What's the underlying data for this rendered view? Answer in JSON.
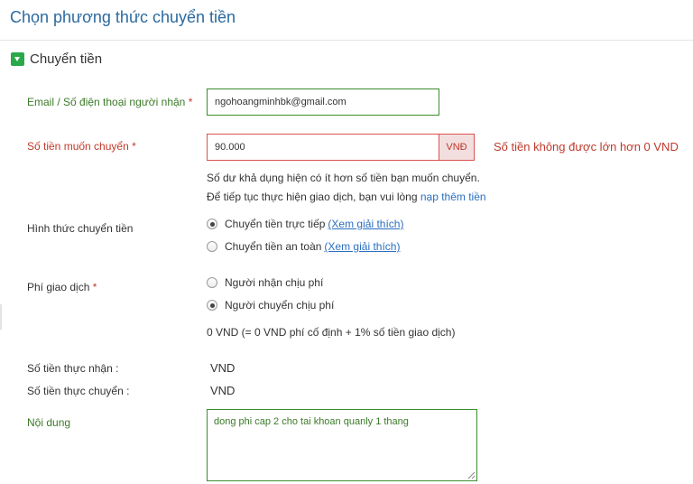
{
  "page": {
    "title": "Chọn phương thức chuyển tiền"
  },
  "section": {
    "title": "Chuyển tiền",
    "toggle_icon": "triangle-down-icon",
    "toggle_color": "#2aa84a"
  },
  "form": {
    "email": {
      "label": "Email / Số điện thoại người nhận",
      "required_mark": "*",
      "value": "ngohoangminhbk@gmail.com"
    },
    "amount": {
      "label": "Số tiền muốn chuyển",
      "required_mark": "*",
      "value": "90.000",
      "currency_addon": "VNĐ",
      "error": "Số tiền không được lớn hơn 0 VND",
      "help_line1": "Số dư khả dụng hiện có ít hơn số tiền bạn muốn chuyển.",
      "help_line2_prefix": "Để tiếp tục thực hiện giao dịch, bạn vui lòng",
      "help_link": "nạp thêm tiền"
    },
    "transfer_method": {
      "label": "Hình thức chuyển tiền",
      "options": [
        {
          "label": "Chuyển tiền trực tiếp",
          "link": "(Xem giải thích)",
          "checked": true
        },
        {
          "label": "Chuyển tiền an toàn",
          "link": "(Xem giải thích)",
          "checked": false
        }
      ]
    },
    "fee": {
      "label": "Phí giao dịch",
      "required_mark": "*",
      "options": [
        {
          "label": "Người nhận chịu phí",
          "checked": false
        },
        {
          "label": "Người chuyển chịu phí",
          "checked": true
        }
      ],
      "summary": "0 VND (= 0 VND phí cố định + 1% số tiền giao dịch)"
    },
    "received": {
      "label": "Số tiền thực nhận :",
      "value": "VND"
    },
    "transferred": {
      "label": "Số tiền thực chuyển :",
      "value": "VND"
    },
    "content": {
      "label": "Nội dung",
      "value": "dong phi cap 2 cho tai khoan quanly 1 thang"
    }
  },
  "colors": {
    "title": "#2b6aa0",
    "label_green": "#3b7a28",
    "error_red": "#c0392b",
    "link_blue": "#2a6fc0"
  }
}
